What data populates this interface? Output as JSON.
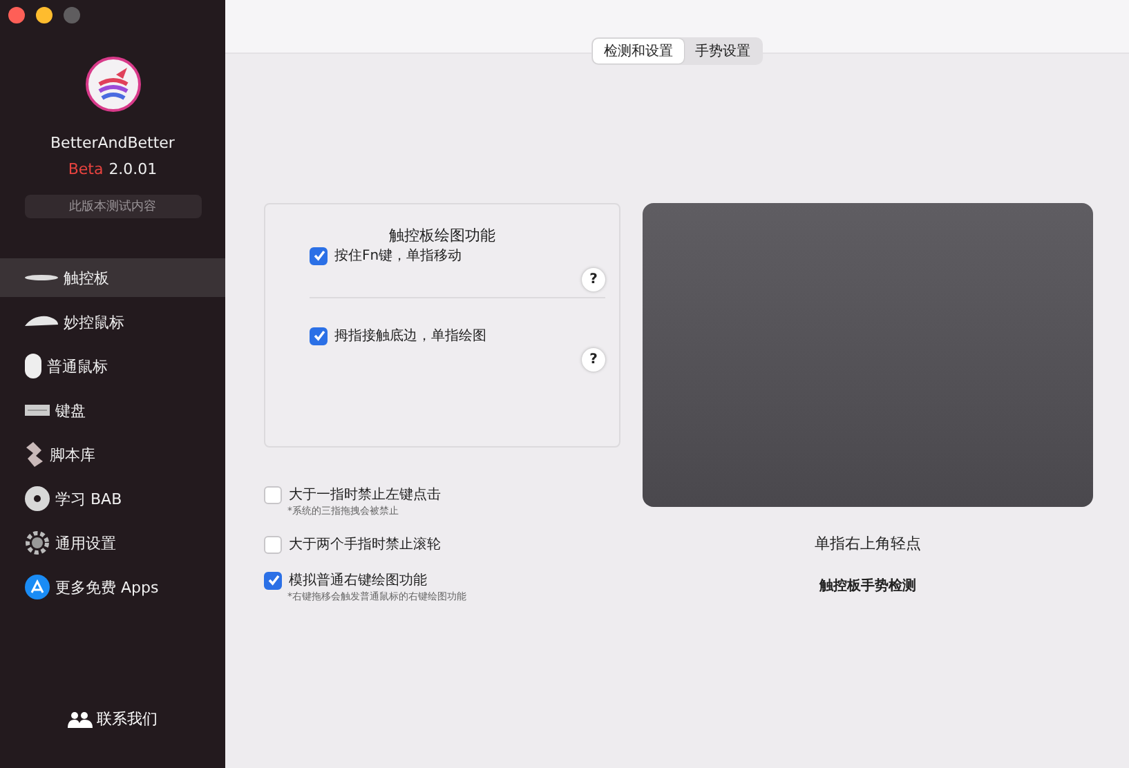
{
  "app": {
    "name": "BetterAndBetter",
    "channel": "Beta",
    "version": "2.0.01",
    "note": "此版本测试内容"
  },
  "sidebar": {
    "items": [
      {
        "label": "触控板",
        "selected": true
      },
      {
        "label": "妙控鼠标",
        "selected": false
      },
      {
        "label": "普通鼠标",
        "selected": false
      },
      {
        "label": "键盘",
        "selected": false
      },
      {
        "label": "脚本库",
        "selected": false
      },
      {
        "label": "学习 BAB",
        "selected": false
      },
      {
        "label": "通用设置",
        "selected": false
      },
      {
        "label": "更多免费 Apps",
        "selected": false
      }
    ],
    "contact": "联系我们"
  },
  "tabs": [
    {
      "label": "检测和设置",
      "selected": true
    },
    {
      "label": "手势设置",
      "selected": false
    }
  ],
  "drawing_panel": {
    "title": "触控板绘图功能",
    "options": [
      {
        "label": "按住Fn键，单指移动",
        "checked": true,
        "help": "?"
      },
      {
        "label": "拇指接触底边，单指绘图",
        "checked": true,
        "help": "?"
      }
    ]
  },
  "options": [
    {
      "label": "大于一指时禁止左键点击",
      "checked": false,
      "note": "*系统的三指拖拽会被禁止"
    },
    {
      "label": "大于两个手指时禁止滚轮",
      "checked": false
    },
    {
      "label": "模拟普通右键绘图功能",
      "checked": true,
      "note": "*右键拖移会触发普通鼠标的右键绘图功能"
    }
  ],
  "trackpad": {
    "gesture": "单指右上角轻点",
    "caption": "触控板手势检测"
  }
}
